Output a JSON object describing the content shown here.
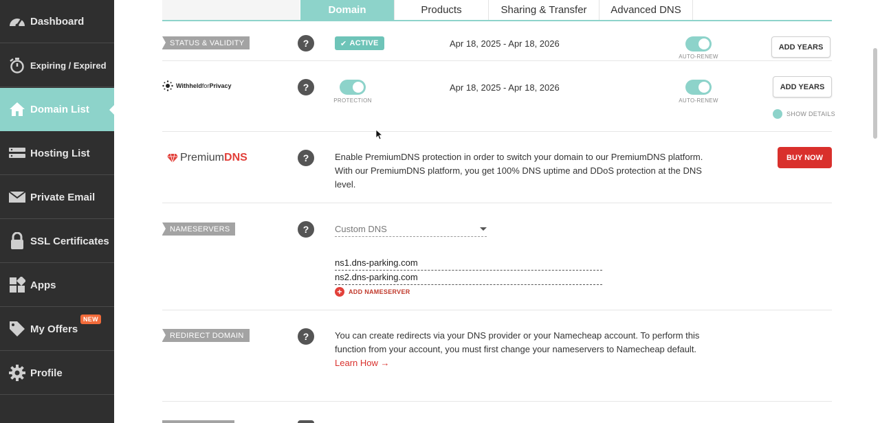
{
  "sidebar": {
    "items": [
      {
        "label": "Dashboard",
        "icon": "dashboard-icon"
      },
      {
        "label": "Expiring / Expired",
        "icon": "stopwatch-icon"
      },
      {
        "label": "Domain List",
        "icon": "home-icon",
        "active": true
      },
      {
        "label": "Hosting List",
        "icon": "server-icon"
      },
      {
        "label": "Private Email",
        "icon": "envelope-icon"
      },
      {
        "label": "SSL Certificates",
        "icon": "lock-icon"
      },
      {
        "label": "Apps",
        "icon": "apps-grid-icon"
      },
      {
        "label": "My Offers",
        "icon": "tag-icon",
        "badge": "NEW"
      },
      {
        "label": "Profile",
        "icon": "gear-icon"
      }
    ]
  },
  "tabs": [
    {
      "label": "Domain",
      "active": true
    },
    {
      "label": "Products"
    },
    {
      "label": "Sharing & Transfer"
    },
    {
      "label": "Advanced DNS"
    }
  ],
  "status": {
    "tag": "STATUS & VALIDITY",
    "badge": "ACTIVE",
    "dates": "Apr 18, 2025 - Apr 18, 2026",
    "auto_renew": "AUTO-RENEW",
    "button": "ADD YEARS"
  },
  "privacy": {
    "logo_prefix": "Withheld",
    "logo_mid": "for",
    "logo_suffix": "Privacy",
    "protection_caption": "PROTECTION",
    "dates": "Apr 18, 2025 - Apr 18, 2026",
    "auto_renew": "AUTO-RENEW",
    "button": "ADD YEARS",
    "show_details": "SHOW DETAILS"
  },
  "premium_dns": {
    "logo_prefix": "Premium",
    "logo_suffix": "DNS",
    "text": "Enable PremiumDNS protection in order to switch your domain to our PremiumDNS platform. With our PremiumDNS platform, you get 100% DNS uptime and DDoS protection at the DNS level.",
    "button": "BUY NOW"
  },
  "nameservers": {
    "tag": "NAMESERVERS",
    "selected": "Custom DNS",
    "ns1": "ns1.dns-parking.com",
    "ns2": "ns2.dns-parking.com",
    "add": "ADD NAMESERVER"
  },
  "redirect": {
    "tag": "REDIRECT DOMAIN",
    "text": "You can create redirects via your DNS provider or your Namecheap account. To perform this function from your account, you must first change your nameservers to Namecheap default.",
    "link": "Learn How →"
  },
  "help_glyph": "?",
  "colors": {
    "accent": "#8dd3ca",
    "sidebar": "#2f2f2f",
    "danger": "#d9302c"
  }
}
